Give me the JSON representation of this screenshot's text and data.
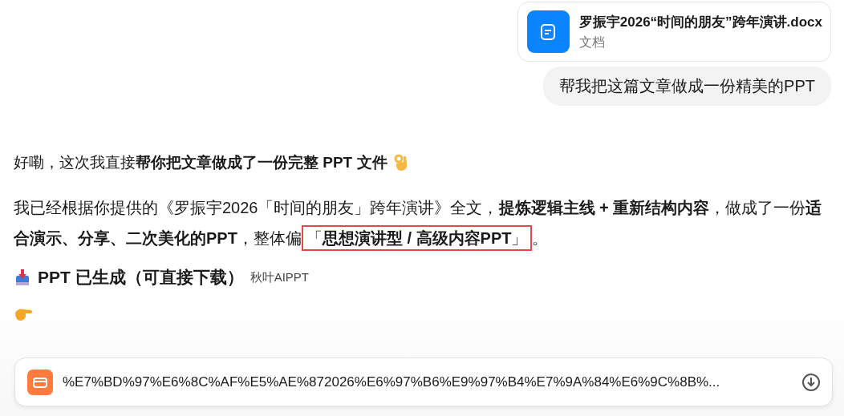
{
  "attachment": {
    "name": "罗振宇2026“时间的朋友”跨年演讲.docx",
    "type": "文档"
  },
  "user_message": "帮我把这篇文章做成一份精美的PPT",
  "reply": {
    "intro": "好嘞，这次我直接**帮你把文章做成了一份完整 PPT 文件**",
    "summary": [
      {
        "text": "我已经根据你提供的《罗振宇2026「时间的朋友」跨年演讲》全文，**提炼逻辑主线 + 重新结构内容**，做成了一份**适合演示、分享、二次美化的PPT**，整体偏",
        "highlighted": false
      },
      {
        "text": "「**思想演讲型 / 高级内容PPT**」",
        "highlighted": true
      },
      {
        "text": "。",
        "highlighted": false
      }
    ],
    "heading": "PPT 已生成（可直接下载）",
    "source": "秋叶AIPPT"
  },
  "download": {
    "filename": "%E7%BD%97%E6%8C%AF%E5%AE%872026%E6%97%B6%E9%97%B4%E7%9A%84%E6%9C%8B%..."
  }
}
